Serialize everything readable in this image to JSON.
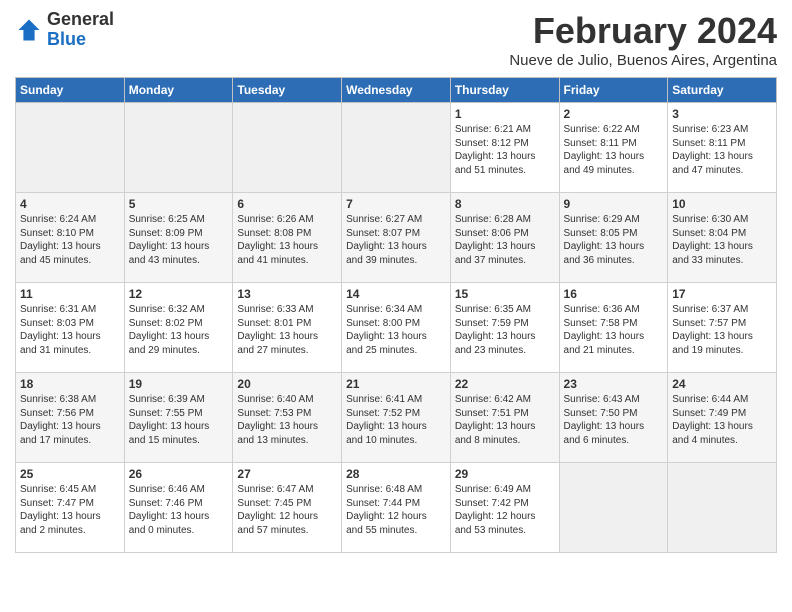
{
  "logo": {
    "general": "General",
    "blue": "Blue"
  },
  "title": "February 2024",
  "subtitle": "Nueve de Julio, Buenos Aires, Argentina",
  "weekdays": [
    "Sunday",
    "Monday",
    "Tuesday",
    "Wednesday",
    "Thursday",
    "Friday",
    "Saturday"
  ],
  "weeks": [
    [
      {
        "day": "",
        "sunrise": "",
        "sunset": "",
        "daylight": "",
        "empty": true
      },
      {
        "day": "",
        "sunrise": "",
        "sunset": "",
        "daylight": "",
        "empty": true
      },
      {
        "day": "",
        "sunrise": "",
        "sunset": "",
        "daylight": "",
        "empty": true
      },
      {
        "day": "",
        "sunrise": "",
        "sunset": "",
        "daylight": "",
        "empty": true
      },
      {
        "day": "1",
        "sunrise": "Sunrise: 6:21 AM",
        "sunset": "Sunset: 8:12 PM",
        "daylight": "Daylight: 13 hours and 51 minutes."
      },
      {
        "day": "2",
        "sunrise": "Sunrise: 6:22 AM",
        "sunset": "Sunset: 8:11 PM",
        "daylight": "Daylight: 13 hours and 49 minutes."
      },
      {
        "day": "3",
        "sunrise": "Sunrise: 6:23 AM",
        "sunset": "Sunset: 8:11 PM",
        "daylight": "Daylight: 13 hours and 47 minutes."
      }
    ],
    [
      {
        "day": "4",
        "sunrise": "Sunrise: 6:24 AM",
        "sunset": "Sunset: 8:10 PM",
        "daylight": "Daylight: 13 hours and 45 minutes."
      },
      {
        "day": "5",
        "sunrise": "Sunrise: 6:25 AM",
        "sunset": "Sunset: 8:09 PM",
        "daylight": "Daylight: 13 hours and 43 minutes."
      },
      {
        "day": "6",
        "sunrise": "Sunrise: 6:26 AM",
        "sunset": "Sunset: 8:08 PM",
        "daylight": "Daylight: 13 hours and 41 minutes."
      },
      {
        "day": "7",
        "sunrise": "Sunrise: 6:27 AM",
        "sunset": "Sunset: 8:07 PM",
        "daylight": "Daylight: 13 hours and 39 minutes."
      },
      {
        "day": "8",
        "sunrise": "Sunrise: 6:28 AM",
        "sunset": "Sunset: 8:06 PM",
        "daylight": "Daylight: 13 hours and 37 minutes."
      },
      {
        "day": "9",
        "sunrise": "Sunrise: 6:29 AM",
        "sunset": "Sunset: 8:05 PM",
        "daylight": "Daylight: 13 hours and 36 minutes."
      },
      {
        "day": "10",
        "sunrise": "Sunrise: 6:30 AM",
        "sunset": "Sunset: 8:04 PM",
        "daylight": "Daylight: 13 hours and 33 minutes."
      }
    ],
    [
      {
        "day": "11",
        "sunrise": "Sunrise: 6:31 AM",
        "sunset": "Sunset: 8:03 PM",
        "daylight": "Daylight: 13 hours and 31 minutes."
      },
      {
        "day": "12",
        "sunrise": "Sunrise: 6:32 AM",
        "sunset": "Sunset: 8:02 PM",
        "daylight": "Daylight: 13 hours and 29 minutes."
      },
      {
        "day": "13",
        "sunrise": "Sunrise: 6:33 AM",
        "sunset": "Sunset: 8:01 PM",
        "daylight": "Daylight: 13 hours and 27 minutes."
      },
      {
        "day": "14",
        "sunrise": "Sunrise: 6:34 AM",
        "sunset": "Sunset: 8:00 PM",
        "daylight": "Daylight: 13 hours and 25 minutes."
      },
      {
        "day": "15",
        "sunrise": "Sunrise: 6:35 AM",
        "sunset": "Sunset: 7:59 PM",
        "daylight": "Daylight: 13 hours and 23 minutes."
      },
      {
        "day": "16",
        "sunrise": "Sunrise: 6:36 AM",
        "sunset": "Sunset: 7:58 PM",
        "daylight": "Daylight: 13 hours and 21 minutes."
      },
      {
        "day": "17",
        "sunrise": "Sunrise: 6:37 AM",
        "sunset": "Sunset: 7:57 PM",
        "daylight": "Daylight: 13 hours and 19 minutes."
      }
    ],
    [
      {
        "day": "18",
        "sunrise": "Sunrise: 6:38 AM",
        "sunset": "Sunset: 7:56 PM",
        "daylight": "Daylight: 13 hours and 17 minutes."
      },
      {
        "day": "19",
        "sunrise": "Sunrise: 6:39 AM",
        "sunset": "Sunset: 7:55 PM",
        "daylight": "Daylight: 13 hours and 15 minutes."
      },
      {
        "day": "20",
        "sunrise": "Sunrise: 6:40 AM",
        "sunset": "Sunset: 7:53 PM",
        "daylight": "Daylight: 13 hours and 13 minutes."
      },
      {
        "day": "21",
        "sunrise": "Sunrise: 6:41 AM",
        "sunset": "Sunset: 7:52 PM",
        "daylight": "Daylight: 13 hours and 10 minutes."
      },
      {
        "day": "22",
        "sunrise": "Sunrise: 6:42 AM",
        "sunset": "Sunset: 7:51 PM",
        "daylight": "Daylight: 13 hours and 8 minutes."
      },
      {
        "day": "23",
        "sunrise": "Sunrise: 6:43 AM",
        "sunset": "Sunset: 7:50 PM",
        "daylight": "Daylight: 13 hours and 6 minutes."
      },
      {
        "day": "24",
        "sunrise": "Sunrise: 6:44 AM",
        "sunset": "Sunset: 7:49 PM",
        "daylight": "Daylight: 13 hours and 4 minutes."
      }
    ],
    [
      {
        "day": "25",
        "sunrise": "Sunrise: 6:45 AM",
        "sunset": "Sunset: 7:47 PM",
        "daylight": "Daylight: 13 hours and 2 minutes."
      },
      {
        "day": "26",
        "sunrise": "Sunrise: 6:46 AM",
        "sunset": "Sunset: 7:46 PM",
        "daylight": "Daylight: 13 hours and 0 minutes."
      },
      {
        "day": "27",
        "sunrise": "Sunrise: 6:47 AM",
        "sunset": "Sunset: 7:45 PM",
        "daylight": "Daylight: 12 hours and 57 minutes."
      },
      {
        "day": "28",
        "sunrise": "Sunrise: 6:48 AM",
        "sunset": "Sunset: 7:44 PM",
        "daylight": "Daylight: 12 hours and 55 minutes."
      },
      {
        "day": "29",
        "sunrise": "Sunrise: 6:49 AM",
        "sunset": "Sunset: 7:42 PM",
        "daylight": "Daylight: 12 hours and 53 minutes."
      },
      {
        "day": "",
        "sunrise": "",
        "sunset": "",
        "daylight": "",
        "empty": true
      },
      {
        "day": "",
        "sunrise": "",
        "sunset": "",
        "daylight": "",
        "empty": true
      }
    ]
  ]
}
